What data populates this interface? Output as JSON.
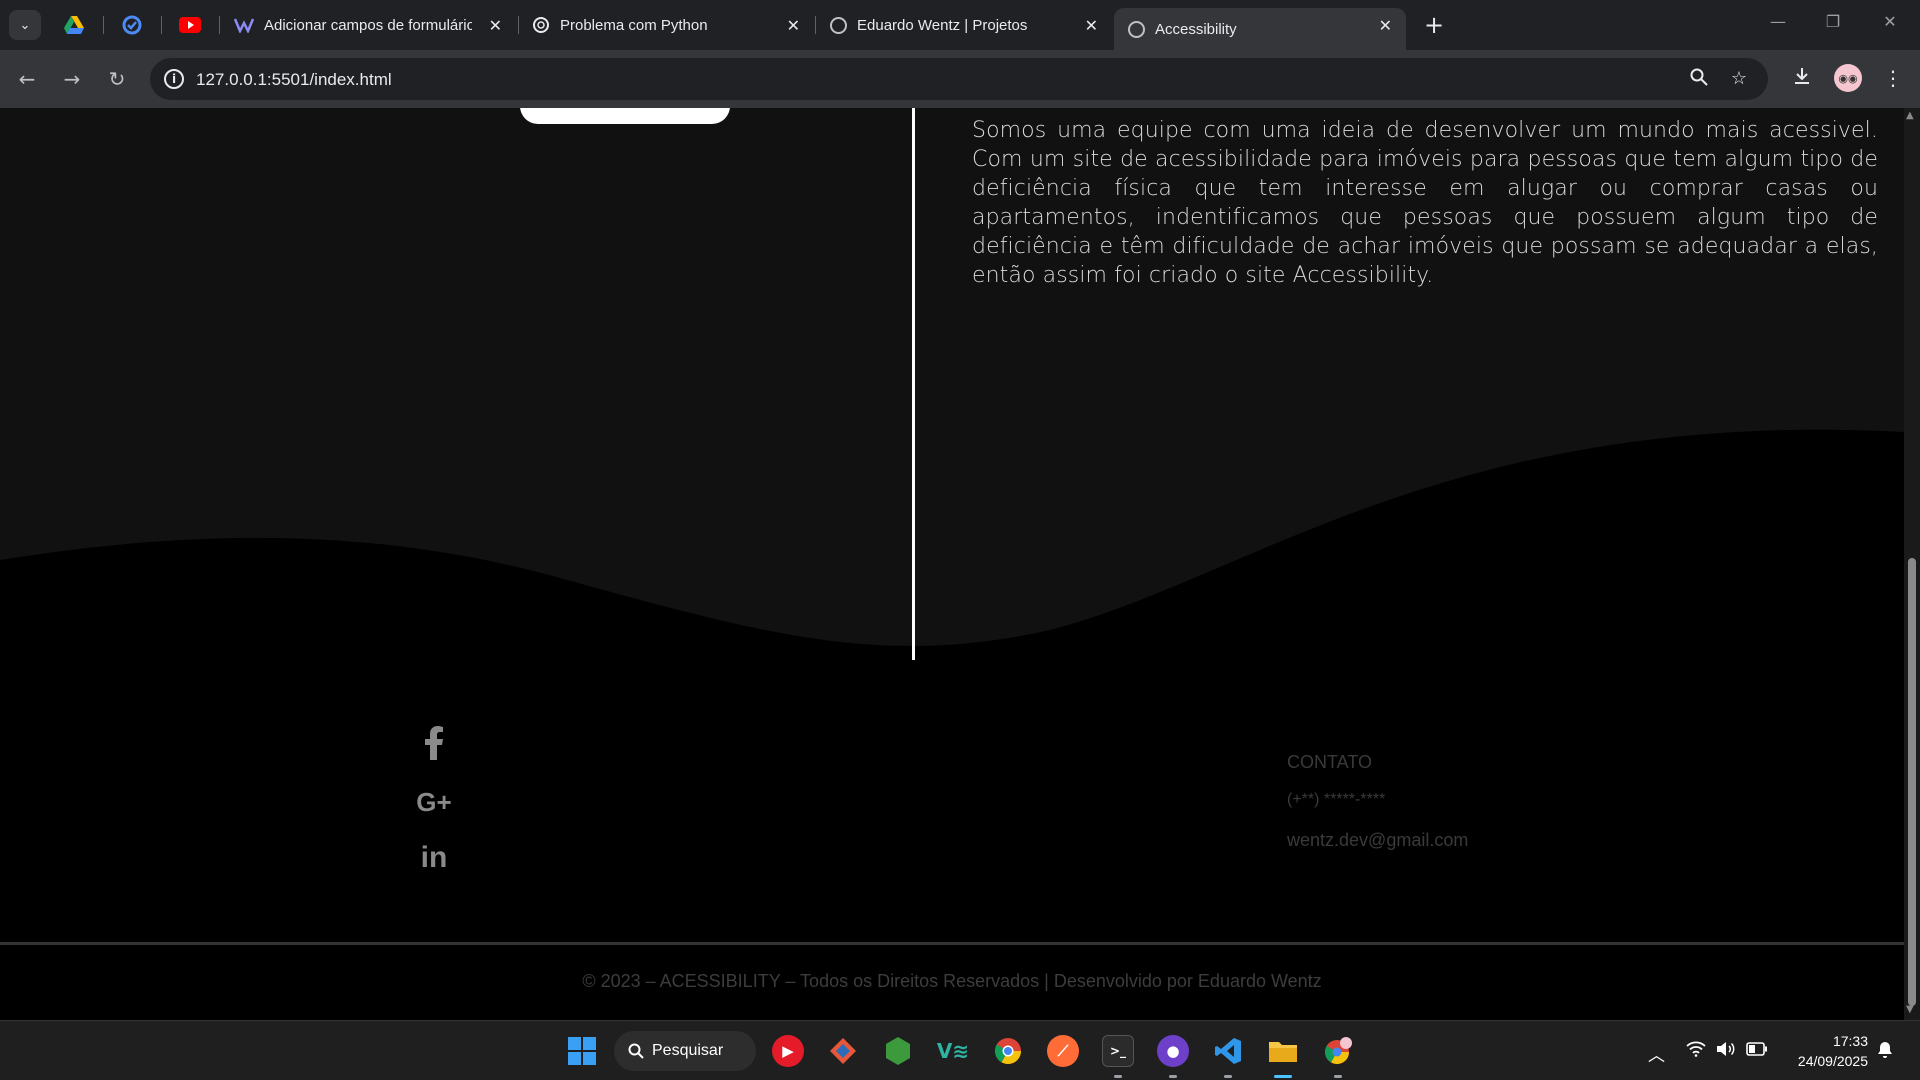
{
  "browser": {
    "tabs": [
      {
        "title": "Adicionar campos de formulário",
        "active": false
      },
      {
        "title": "Problema com Python",
        "active": false
      },
      {
        "title": "Eduardo Wentz | Projetos",
        "active": false
      },
      {
        "title": "Accessibility",
        "active": true
      }
    ],
    "url": "127.0.0.1:5501/index.html"
  },
  "page": {
    "about_text": "Somos uma equipe com uma ideia de desenvolver um mundo mais acessivel. Com um site de acessibilidade para imóveis para pessoas que tem algum tipo de deficiência física que tem interesse em alugar ou comprar casas ou apartamentos, indentificamos que pessoas que possuem algum tipo de deficiência e têm dificuldade de achar imóveis que possam se adequadar a elas, então assim foi criado o site Accessibility.",
    "social": {
      "facebook": "f",
      "googleplus": "G+",
      "linkedin": "in"
    },
    "contact": {
      "title": "CONTATO",
      "phone": "(+**) *****-****",
      "email": "wentz.dev@gmail.com"
    },
    "copyright": "© 2023 – ACESSIBILITY – Todos os Direitos Reservados | Desenvolvido por Eduardo Wentz"
  },
  "taskbar": {
    "search_label": "Pesquisar",
    "time": "17:33",
    "date": "24/09/2025"
  },
  "colors": {
    "page_bg": "#111111",
    "footer_bg": "#000000",
    "text_light": "#d9d9d9",
    "footer_text": "#3d3d3d"
  }
}
